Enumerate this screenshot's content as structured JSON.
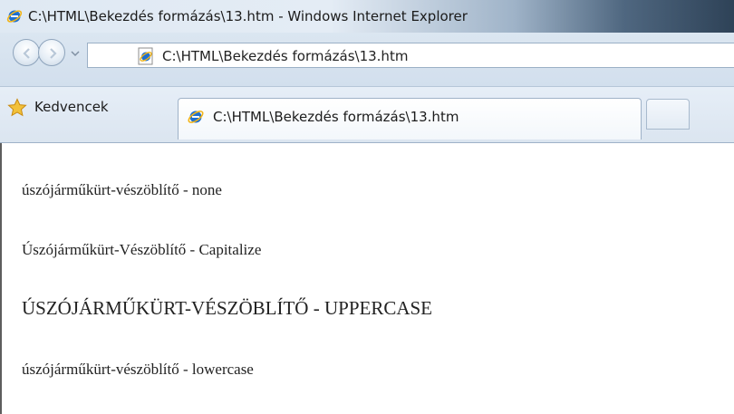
{
  "window": {
    "title": "C:\\HTML\\Bekezdés formázás\\13.htm - Windows Internet Explorer",
    "icon": "ie-icon"
  },
  "nav": {
    "back": "back-arrow-icon",
    "forward": "forward-arrow-icon",
    "address": "C:\\HTML\\Bekezdés formázás\\13.htm",
    "address_icon": "ie-page-icon"
  },
  "favorites": {
    "label": "Kedvencek",
    "icon": "star-icon"
  },
  "tab": {
    "label": "C:\\HTML\\Bekezdés formázás\\13.htm",
    "icon": "ie-icon"
  },
  "content": {
    "lines": [
      "úszójárműkürt-vészöblítő - none",
      "Úszójárműkürt-Vészöblítő - Capitalize",
      "ÚSZÓJÁRMŰKÜRT-VÉSZÖBLÍTŐ - UPPERCASE",
      "úszójárműkürt-vészöblítő - lowercase"
    ]
  },
  "colors": {
    "ie_blue": "#1e6fd0",
    "ie_ring": "#f2b417",
    "star": "#f2c13a"
  }
}
